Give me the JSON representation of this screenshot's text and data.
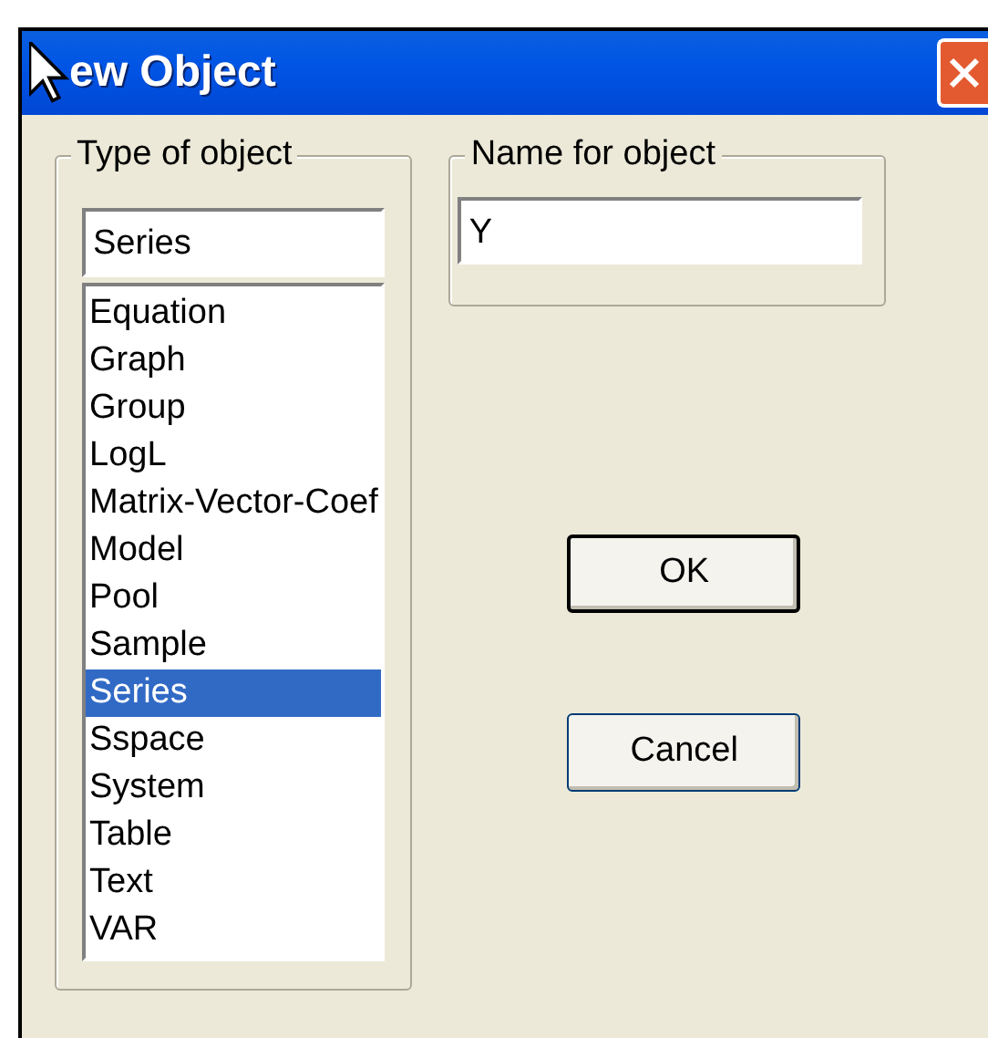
{
  "window": {
    "title": "ew Object"
  },
  "type_group": {
    "legend": "Type of object",
    "value": "Series",
    "items": [
      {
        "label": "Equation",
        "selected": false
      },
      {
        "label": "Graph",
        "selected": false
      },
      {
        "label": "Group",
        "selected": false
      },
      {
        "label": "LogL",
        "selected": false
      },
      {
        "label": "Matrix-Vector-Coef",
        "selected": false
      },
      {
        "label": "Model",
        "selected": false
      },
      {
        "label": "Pool",
        "selected": false
      },
      {
        "label": "Sample",
        "selected": false
      },
      {
        "label": "Series",
        "selected": true
      },
      {
        "label": "Sspace",
        "selected": false
      },
      {
        "label": "System",
        "selected": false
      },
      {
        "label": "Table",
        "selected": false
      },
      {
        "label": "Text",
        "selected": false
      },
      {
        "label": "VAR",
        "selected": false
      }
    ]
  },
  "name_group": {
    "legend": "Name for object",
    "value": "Y"
  },
  "buttons": [
    {
      "label": "OK",
      "default": true
    },
    {
      "label": "Cancel",
      "default": false
    }
  ]
}
